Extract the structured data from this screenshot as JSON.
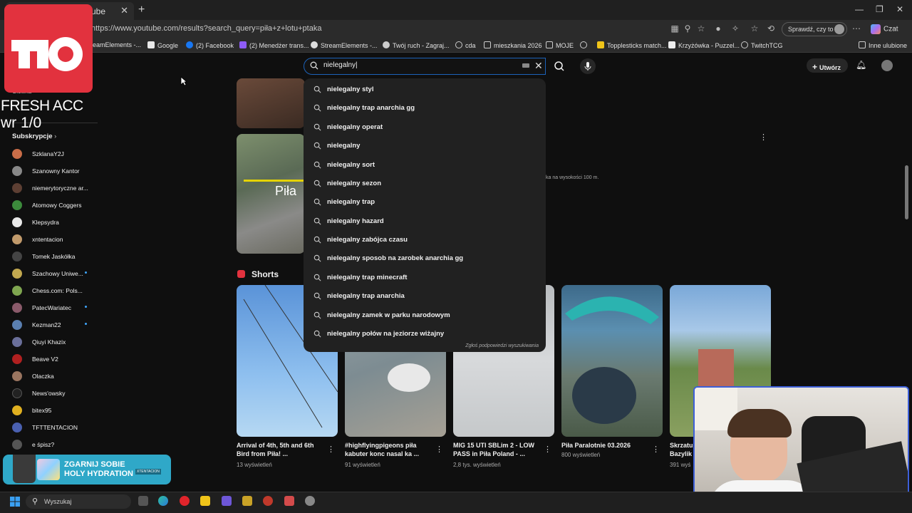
{
  "browser": {
    "tab_title": "ube",
    "url": "https://www.youtube.com/results?search_query=piła+z+lotu+ptaka",
    "profile_button": "Sprawdź, czy to Ty",
    "chat_label": "Czat",
    "bookmarks": [
      "eamElements -...",
      "Google",
      "(2) Facebook",
      "(2) Menedżer trans...",
      "StreamElements -...",
      "Twój ruch - Zagraj...",
      "cda",
      "mieszkania 2026",
      "MOJE",
      "Topplesticks match...",
      "Krzyżówka - Puzzel...",
      "TwitchTCG"
    ],
    "other_favorites": "Inne ulubione"
  },
  "overlay": {
    "fresh_acc": "FRESH ACC",
    "wr": "wr 1/0",
    "ad_line1": "ZGARNIJ SOBIE",
    "ad_line2": "HOLY HYDRATION",
    "ad_tag": "XTENTACION"
  },
  "youtube": {
    "search_value": "nielegalny",
    "create_label": "Utwórz",
    "suggestions": [
      "nielegalny styl",
      "nielegalny trap anarchia gg",
      "nielegalny operat",
      "nielegalny",
      "nielegalny sort",
      "nielegalny sezon",
      "nielegalny trap",
      "nielegalny hazard",
      "nielegalny zabójca czasu",
      "nielegalny sposob na zarobek anarchia gg",
      "nielegalny trap minecraft",
      "nielegalny trap anarchia",
      "nielegalny zamek w parku narodowym",
      "nielegalny połów na jeziorze wiżajny"
    ],
    "report_link": "Zgłoś podpowiedzi wyszukiwania",
    "sidebar": {
      "home_partial": "Główna",
      "subscriptions_label": "Subskrypcje",
      "subs": [
        "SzklanaY2J",
        "Szanowny Kantor",
        "niemerytoryczne ar...",
        "Atomowy Coggers",
        "Klepsydra",
        "xntentacion",
        "Tomek Jaskółka",
        "Szachowy Uniwe...",
        "Chess.com: Pols...",
        "PatecWariatec",
        "Kezman22",
        "Qiuyi Khazix",
        "Beave V2",
        "Olaczka",
        "News'owsky",
        "bitex95",
        "TFTTENTACION",
        "e śpisz?"
      ]
    },
    "video_text_partial": "ka na wysokości 100 m.",
    "thumb_caption_partial": "Piła",
    "shorts_label": "Shorts",
    "shorts": [
      {
        "title1": "Arrival of 4th, 5th and 6th",
        "title2": "Bird from Piła! ...",
        "views": "13 wyświetleń"
      },
      {
        "title1": "#highflyingpigeons piła",
        "title2": "kabuter  konc nasal ka ...",
        "views": "91 wyświetleń"
      },
      {
        "title1": "MIG 15 UTI SBLim 2 - LOW",
        "title2": "PASS in Piła Poland - ...",
        "views": "2,8 tys. wyświetleń"
      },
      {
        "title1": "Piła Paralotnie 03.2026",
        "title2": "",
        "views": "800 wyświetleń"
      },
      {
        "title1": "Skrzatu",
        "title2": "Bazylik",
        "views": "391 wyś"
      }
    ]
  },
  "taskbar": {
    "search_placeholder": "Wyszukaj"
  },
  "colors": {
    "bg": "#0f0f0f",
    "accent_blue": "#1c62b9",
    "dropdown_bg": "#212121",
    "logo_red": "#e2323e"
  }
}
